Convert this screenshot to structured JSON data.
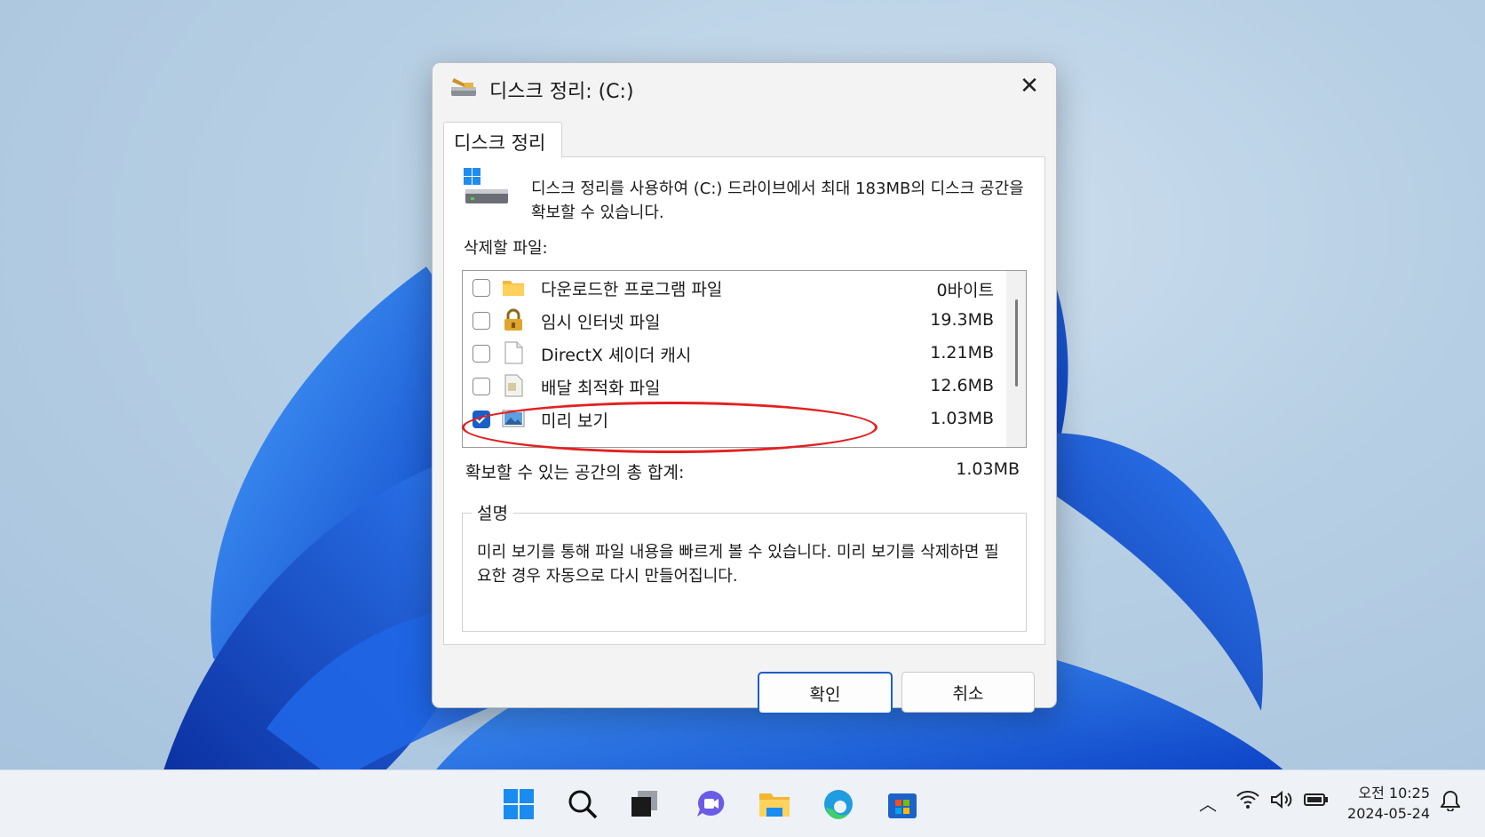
{
  "dialog": {
    "title": "디스크 정리:  (C:)",
    "tab_label": "디스크 정리",
    "intro_text": "디스크 정리를 사용하여 (C:) 드라이브에서 최대 183MB의 디스크 공간을 확보할 수 있습니다.",
    "files_label": "삭제할 파일:",
    "files": [
      {
        "name": "다운로드한 프로그램 파일",
        "size": "0바이트",
        "checked": false,
        "icon": "folder-icon"
      },
      {
        "name": "임시 인터넷 파일",
        "size": "19.3MB",
        "checked": false,
        "icon": "lock-icon"
      },
      {
        "name": "DirectX 셰이더 캐시",
        "size": "1.21MB",
        "checked": false,
        "icon": "blank-file-icon"
      },
      {
        "name": "배달 최적화 파일",
        "size": "12.6MB",
        "checked": false,
        "icon": "document-icon"
      },
      {
        "name": "미리 보기",
        "size": "1.03MB",
        "checked": true,
        "icon": "picture-icon"
      }
    ],
    "total_label": "확보할 수 있는 공간의 총 합계:",
    "total_value": "1.03MB",
    "description_legend": "설명",
    "description_text": "미리 보기를 통해 파일 내용을 빠르게 볼 수 있습니다. 미리 보기를 삭제하면 필요한 경우 자동으로 다시 만들어집니다.",
    "ok_label": "확인",
    "cancel_label": "취소"
  },
  "taskbar": {
    "icons": [
      "start-icon",
      "search-icon",
      "task-view-icon",
      "chat-icon",
      "file-explorer-icon",
      "edge-icon",
      "store-icon"
    ],
    "tray_icons": [
      "chevron-up-icon",
      "wifi-icon",
      "volume-icon",
      "battery-icon",
      "bell-icon"
    ],
    "clock": {
      "time": "오전 10:25",
      "date": "2024-05-24"
    }
  },
  "colors": {
    "accent": "#1a5fc8",
    "annotation": "#e32020"
  }
}
